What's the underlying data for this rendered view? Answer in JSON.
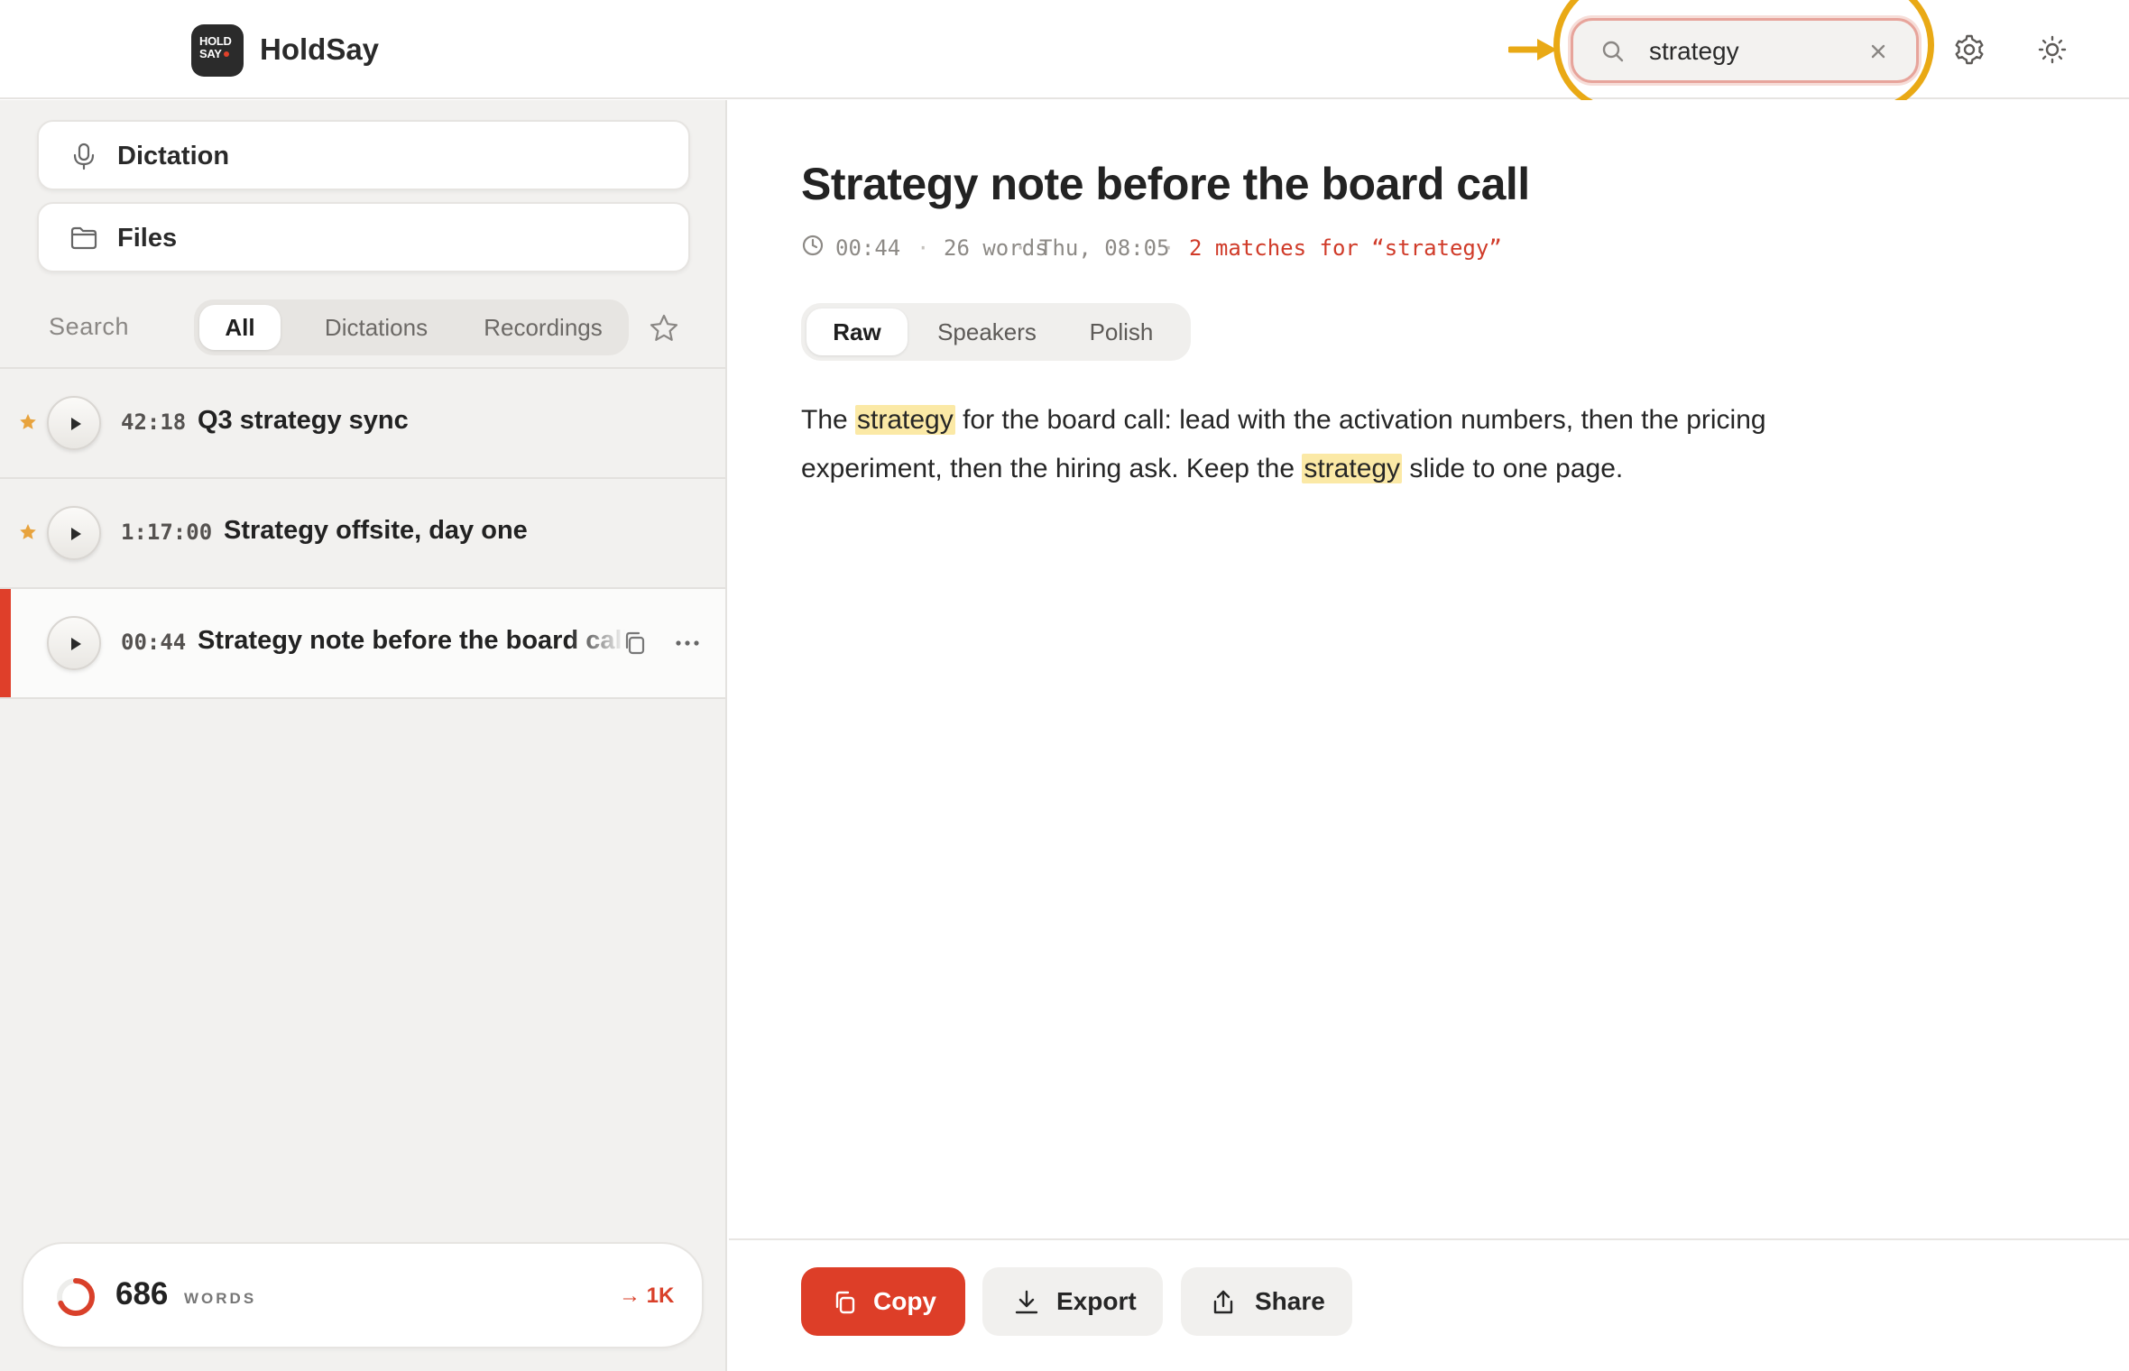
{
  "app": {
    "logo_line1": "HOLD",
    "logo_line2": "SAY",
    "name": "HoldSay"
  },
  "header": {
    "search_value": "strategy",
    "search_icon": "search-icon",
    "clear_icon": "close-icon",
    "settings_icon": "gear-icon",
    "theme_icon": "sun-icon",
    "highlight_color": "#e9a915"
  },
  "sidebar": {
    "nav": [
      {
        "label": "Dictation",
        "icon": "microphone-icon"
      },
      {
        "label": "Files",
        "icon": "folder-icon"
      }
    ],
    "search_label": "Search",
    "filters": [
      "All",
      "Dictations",
      "Recordings"
    ],
    "active_filter": "All",
    "favorites_icon": "star-icon",
    "items": [
      {
        "duration": "42:18",
        "title": "Q3 strategy sync",
        "starred": true,
        "selected": false
      },
      {
        "duration": "1:17:00",
        "title": "Strategy offsite, day one",
        "starred": true,
        "selected": false
      },
      {
        "duration": "00:44",
        "title": "Strategy note before the board call",
        "starred": false,
        "selected": true
      }
    ],
    "stats": {
      "count": "686",
      "unit": "WORDS",
      "goal": "→ 1K",
      "progress": 0.686
    }
  },
  "main": {
    "title": "Strategy note before the board call",
    "meta": {
      "duration": "00:44",
      "words": "26 words",
      "date": "Thu, 08:05",
      "matches": "2 matches for “strategy”",
      "separator": "·"
    },
    "tabs": [
      "Raw",
      "Speakers",
      "Polish"
    ],
    "active_tab": "Raw",
    "transcript": {
      "p1": "The ",
      "h1": "strategy",
      "p2": " for the board call: lead with the activation numbers, then the pricing experiment, then the hiring ask. Keep the ",
      "h2": "strategy",
      "p3": " slide to one page."
    },
    "actions": {
      "copy": "Copy",
      "export": "Export",
      "share": "Share"
    }
  },
  "colors": {
    "accent": "#dd3e28",
    "match_highlight": "#fbe9a6",
    "star": "#e8a33d"
  }
}
